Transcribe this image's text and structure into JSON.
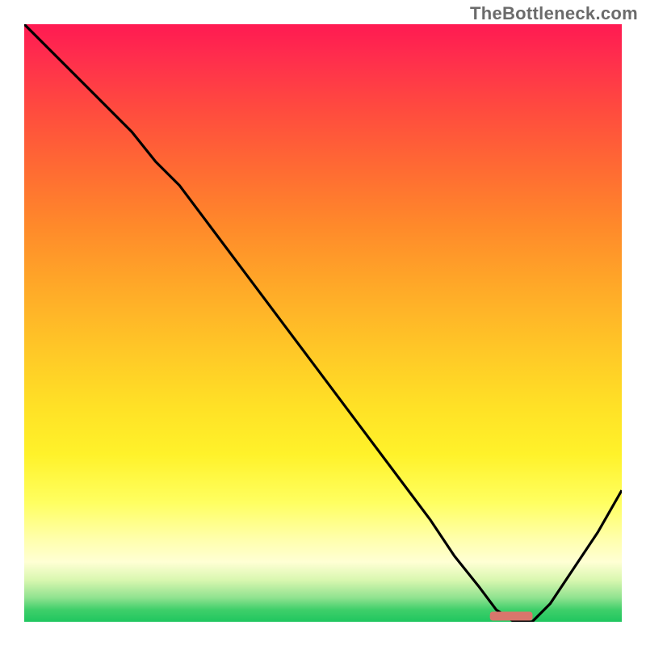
{
  "attribution": "TheBottleneck.com",
  "chart_data": {
    "type": "line",
    "title": "",
    "xlabel": "",
    "ylabel": "",
    "xlim": [
      0,
      100
    ],
    "ylim": [
      0,
      100
    ],
    "grid": false,
    "legend": false,
    "background": "heatmap_gradient_red_to_green_vertical",
    "series": [
      {
        "name": "bottleneck-curve",
        "x": [
          0,
          6,
          12,
          18,
          22,
          26,
          32,
          38,
          44,
          50,
          56,
          62,
          68,
          72,
          76,
          79,
          82,
          85,
          88,
          92,
          96,
          100
        ],
        "y": [
          100,
          94,
          88,
          82,
          77,
          73,
          65,
          57,
          49,
          41,
          33,
          25,
          17,
          11,
          6,
          2,
          0,
          0,
          3,
          9,
          15,
          22
        ]
      }
    ],
    "annotations": [
      {
        "name": "optimum-marker",
        "type": "rect",
        "x_range": [
          78,
          85
        ],
        "y": 0,
        "color": "#d9766c"
      }
    ]
  }
}
